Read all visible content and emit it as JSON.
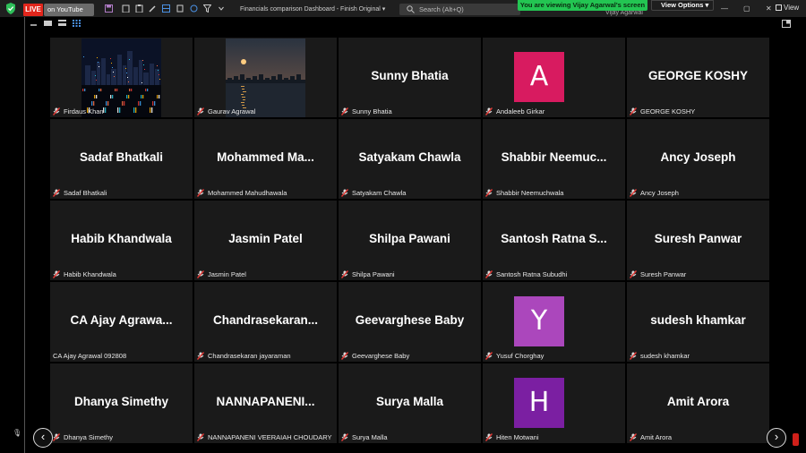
{
  "topbar": {
    "live_label": "LIVE",
    "youtube_label": "on YouTube",
    "doc_title": "Financials comparison Dashboard - Finish Original",
    "search_placeholder": "Search (Alt+Q)",
    "viewing_banner": "You are viewing Vijay Agarwal's screen",
    "view_options_label": "View Options",
    "top_user_name": "Vijay Agarwal",
    "view_label": "View",
    "accent_green": "#23c552",
    "live_red": "#e2261c"
  },
  "participants": [
    {
      "display": "",
      "label": "Firdaus Khan",
      "type": "photo-city",
      "muted": true
    },
    {
      "display": "",
      "label": "Gaurav Agrawal",
      "type": "photo-moon",
      "muted": true
    },
    {
      "display": "Sunny Bhatia",
      "label": "Sunny Bhatia",
      "type": "name",
      "muted": true
    },
    {
      "display": "A",
      "label": "Andaleeb Girkar",
      "type": "avatar",
      "color": "#d81b60",
      "muted": true
    },
    {
      "display": "GEORGE KOSHY",
      "label": "GEORGE KOSHY",
      "type": "name",
      "muted": true
    },
    {
      "display": "Sadaf Bhatkali",
      "label": "Sadaf Bhatkali",
      "type": "name",
      "muted": true
    },
    {
      "display": "Mohammed Ma...",
      "label": "Mohammed Mahudhawala",
      "type": "name",
      "muted": true
    },
    {
      "display": "Satyakam Chawla",
      "label": "Satyakam Chawla",
      "type": "name",
      "muted": true
    },
    {
      "display": "Shabbir Neemuc...",
      "label": "Shabbir Neemuchwala",
      "type": "name",
      "muted": true
    },
    {
      "display": "Ancy Joseph",
      "label": "Ancy Joseph",
      "type": "name",
      "muted": true
    },
    {
      "display": "Habib Khandwala",
      "label": "Habib Khandwala",
      "type": "name",
      "muted": true
    },
    {
      "display": "Jasmin Patel",
      "label": "Jasmin Patel",
      "type": "name",
      "muted": true
    },
    {
      "display": "Shilpa Pawani",
      "label": "Shilpa Pawani",
      "type": "name",
      "muted": true
    },
    {
      "display": "Santosh Ratna S...",
      "label": "Santosh Ratna Subudhi",
      "type": "name",
      "muted": true
    },
    {
      "display": "Suresh Panwar",
      "label": "Suresh Panwar",
      "type": "name",
      "muted": true
    },
    {
      "display": "CA Ajay Agrawa...",
      "label": "CA Ajay Agrawal 092808",
      "type": "name",
      "muted": false
    },
    {
      "display": "Chandrasekaran...",
      "label": "Chandrasekaran jayaraman",
      "type": "name",
      "muted": true
    },
    {
      "display": "Geevarghese Baby",
      "label": "Geevarghese Baby",
      "type": "name",
      "muted": true
    },
    {
      "display": "Y",
      "label": "Yusuf Chorghay",
      "type": "avatar",
      "color": "#ab47bc",
      "muted": true
    },
    {
      "display": "sudesh khamkar",
      "label": "sudesh khamkar",
      "type": "name",
      "muted": true
    },
    {
      "display": "Dhanya Simethy",
      "label": "Dhanya Simethy",
      "type": "name",
      "muted": true
    },
    {
      "display": "NANNAPANENI...",
      "label": "NANNAPANENI VEERAIAH CHOUDARY",
      "type": "name",
      "muted": true
    },
    {
      "display": "Surya Malla",
      "label": "Surya Malla",
      "type": "name",
      "muted": true
    },
    {
      "display": "H",
      "label": "Hiten Motwani",
      "type": "avatar",
      "color": "#7b1fa2",
      "muted": true
    },
    {
      "display": "Amit Arora",
      "label": "Amit Arora",
      "type": "name",
      "muted": true
    }
  ],
  "nav": {
    "prev_icon": "chevron-left-icon",
    "next_icon": "chevron-right-icon"
  }
}
